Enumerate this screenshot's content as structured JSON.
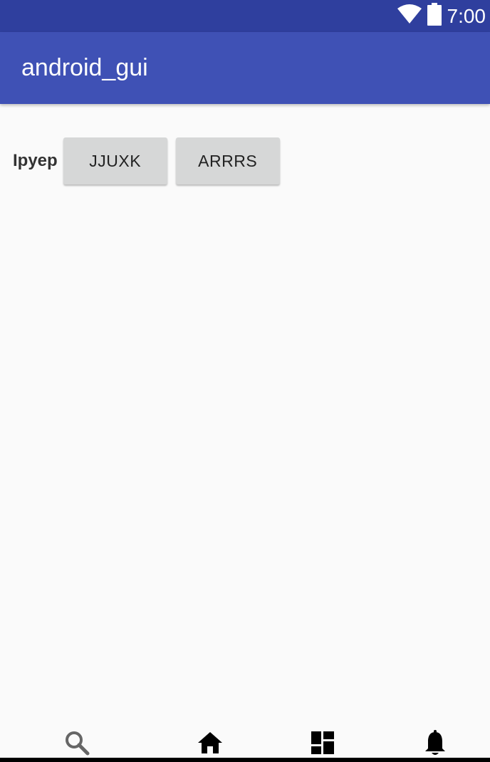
{
  "status_bar": {
    "time": "7:00",
    "icons": [
      "wifi-icon",
      "battery-icon"
    ]
  },
  "app_bar": {
    "title": "android_gui"
  },
  "main": {
    "label": "Ipyep",
    "buttons": [
      {
        "label": "JJUXK"
      },
      {
        "label": "ARRRS"
      }
    ]
  },
  "bottom_nav": {
    "items": [
      "search-icon",
      "home-icon",
      "dashboard-icon",
      "notifications-icon"
    ]
  },
  "colors": {
    "status_bar": "#2f3f9e",
    "app_bar": "#3f51b5",
    "background": "#fafafa",
    "button": "#d6d7d7"
  }
}
